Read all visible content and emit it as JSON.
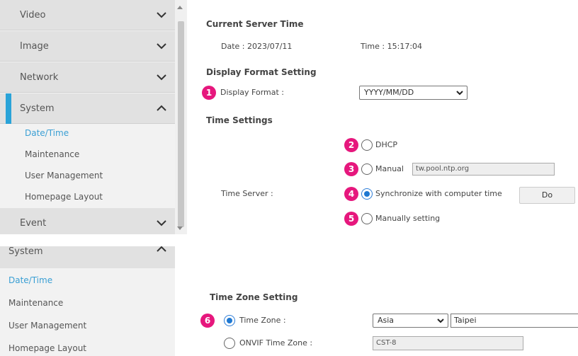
{
  "colors": {
    "accent": "#2aa3d8",
    "badge": "#e6177d",
    "radio_selected": "#1f78d1"
  },
  "top": {
    "sidebar": {
      "items": [
        {
          "label": "Video",
          "icon": "chevron-down-icon"
        },
        {
          "label": "Image",
          "icon": "chevron-down-icon"
        },
        {
          "label": "Network",
          "icon": "chevron-down-icon"
        },
        {
          "label": "System",
          "icon": "chevron-up-icon"
        },
        {
          "label": "Event",
          "icon": "chevron-down-icon"
        }
      ],
      "sub_items": [
        "Date/Time",
        "Maintenance",
        "User Management",
        "Homepage Layout"
      ]
    },
    "current_server_time": {
      "heading": "Current Server Time",
      "date": "Date : 2023/07/11",
      "time": "Time : 15:17:04"
    },
    "display_format": {
      "heading": "Display Format Setting",
      "badge": "1",
      "label": "Display Format :",
      "value": "YYYY/MM/DD"
    },
    "time_settings": {
      "heading": "Time Settings",
      "server_label": "Time Server :",
      "options": [
        {
          "badge": "2",
          "label": "DHCP",
          "selected": false
        },
        {
          "badge": "3",
          "label": "Manual",
          "selected": false,
          "input_value": "tw.pool.ntp.org"
        },
        {
          "badge": "4",
          "label": "Synchronize with computer time",
          "selected": true,
          "button": "Do"
        },
        {
          "badge": "5",
          "label": "Manually setting",
          "selected": false
        }
      ]
    }
  },
  "bottom": {
    "sidebar": {
      "header": {
        "label": "System",
        "icon": "chevron-up-icon"
      },
      "sub_items": [
        "Date/Time",
        "Maintenance",
        "User Management",
        "Homepage Layout"
      ]
    },
    "time_zone": {
      "heading": "Time Zone Setting",
      "badge": "6",
      "tz_label": "Time Zone :",
      "region": "Asia",
      "city": "Taipei",
      "onvif_label": "ONVIF Time Zone :",
      "onvif_value": "CST-8"
    }
  }
}
